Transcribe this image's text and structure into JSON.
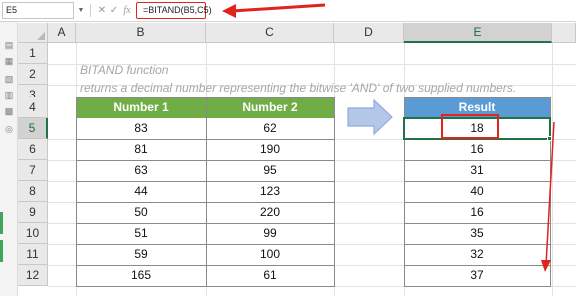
{
  "formula_bar": {
    "name_box": "E5",
    "formula": "=BITAND(B5,C5)",
    "icons": [
      "dropdown-arrow",
      "cancel-icon",
      "enter-icon",
      "function-icon"
    ]
  },
  "columns": [
    "A",
    "B",
    "C",
    "D",
    "E"
  ],
  "rows": [
    "1",
    "2",
    "3",
    "4",
    "5",
    "6",
    "7",
    "8",
    "9",
    "10",
    "11",
    "12"
  ],
  "description": {
    "title": "BITAND  function",
    "subtitle": "returns a decimal number representing the bitwise 'AND' of two supplied numbers."
  },
  "table": {
    "headers": [
      "Number 1",
      "Number 2"
    ],
    "rows": [
      [
        "83",
        "62"
      ],
      [
        "81",
        "190"
      ],
      [
        "63",
        "95"
      ],
      [
        "44",
        "123"
      ],
      [
        "50",
        "220"
      ],
      [
        "51",
        "99"
      ],
      [
        "59",
        "100"
      ],
      [
        "165",
        "61"
      ]
    ]
  },
  "result": {
    "header": "Result",
    "values": [
      "18",
      "16",
      "31",
      "40",
      "16",
      "35",
      "32",
      "37"
    ]
  },
  "colors": {
    "table_header": "#70ad47",
    "result_header": "#5b9bd5",
    "highlight": "#e0231c",
    "selection": "#217346"
  }
}
